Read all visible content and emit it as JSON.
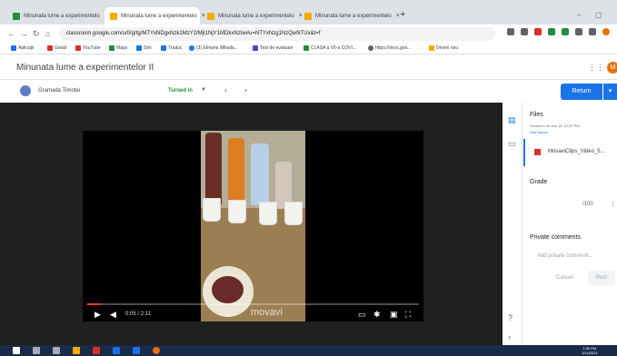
{
  "browser": {
    "tabs": [
      {
        "label": "Minunata lume a experimentelo",
        "close": "×"
      },
      {
        "label": "Minunata lume a experimentelo",
        "close": "×"
      },
      {
        "label": "Minunata lume a experimentelo",
        "close": "×"
      },
      {
        "label": "Minunata lume a experimentelo",
        "close": "×"
      }
    ],
    "new_tab": "+",
    "url": "classroom.google.com/u/0/g/tg/MTYxNDgxNzk1MzY2/MjI1NjY1MDkxNzIw#u=NTYxNzg1NzQwNTUx&t=f",
    "bookmarks": [
      "Aplicații",
      "Gmail",
      "YouTube",
      "Maps",
      "Stiri",
      "Traduc",
      "(3) Elmaria Mihaila...",
      "Test de evaluare",
      "CLASA a VII-a COVI...",
      "https://docs.goo...",
      "Desen nou"
    ]
  },
  "classroom": {
    "title": "Minunata lume a experimentelor II",
    "avatar_letter": "M",
    "student_name": "Gramada Timotei",
    "status": "Turned in",
    "return_label": "Return"
  },
  "video": {
    "time": "0:05 / 2:11",
    "watermark": "movavi",
    "progress": 0.04,
    "progress_color": "#e53935"
  },
  "panel": {
    "files_heading": "Files",
    "turned_in_note": "Turned in on Jan 14, 12:07 PM",
    "see_history": "See history",
    "file_name": "MovaviClips_Video_5...",
    "grade_heading": "Grade",
    "grade_value": "/100",
    "private_comments_heading": "Private comments",
    "comment_placeholder": "Add private comment...",
    "cancel_label": "Cancel",
    "post_label": "Post"
  },
  "taskbar": {
    "clock_time": "1:00 PM",
    "clock_date": "1/14/2021"
  },
  "colors": {
    "accent": "#1a73e8",
    "turned_in": "#1e8e3e",
    "classroom_green": "#1e8e3e"
  }
}
